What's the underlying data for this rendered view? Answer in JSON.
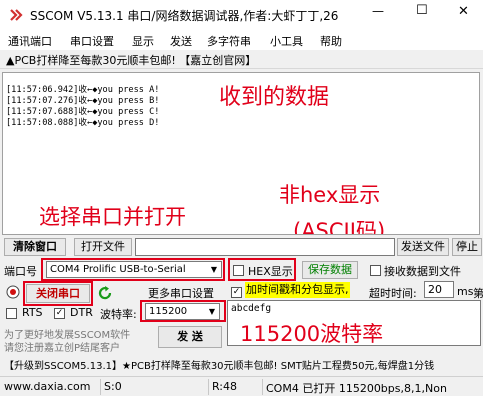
{
  "window": {
    "title": "SSCOM V5.13.1 串口/网络数据调试器,作者:大虾丁丁,26",
    "min_glyph": "—",
    "max_glyph": "☐",
    "close_glyph": "✕"
  },
  "menu": [
    "通讯端口",
    "串口设置",
    "显示",
    "发送",
    "多字符串",
    "小工具",
    "帮助"
  ],
  "ad_bar": "▲PCB打样降至每款30元顺丰包邮!  【嘉立创官网】",
  "receive_lines": [
    "[11:57:06.942]收←◆you press A!",
    "[11:57:07.276]收←◆you press B!",
    "[11:57:07.688]收←◆you press C!",
    "[11:57:08.088]收←◆you press D!"
  ],
  "annotations": {
    "received": "收到的数据",
    "select_port": "选择串口并打开",
    "non_hex": "非hex显示",
    "ascii": "(ASCII码)",
    "baud": "115200波特率"
  },
  "toolbar": {
    "clear_window": "清除窗口",
    "open_file": "打开文件",
    "send_file": "发送文件",
    "stop": "停止"
  },
  "port_row": {
    "port_label": "端口号",
    "port_value": "COM4 Prolific USB-to-Serial",
    "hex_display_label": "HEX显示",
    "save_data": "保存数据",
    "recv_to_file": "接收数据到文件"
  },
  "row3": {
    "close_port": "关闭串口",
    "more_settings": "更多串口设置",
    "timestamp_label": "加时间戳和分包显示,",
    "timeout_label": "超时时间:",
    "timeout_value": "20",
    "timeout_unit": "ms",
    "rest_label": "第"
  },
  "row4": {
    "rts": "RTS",
    "dtr": "DTR",
    "baud_label": "波特率:",
    "baud_value": "115200",
    "send_text": "abcdefg"
  },
  "promo": {
    "line1": "为了更好地发展SSCOM软件",
    "line2": "请您注册嘉立创P结尾客户",
    "send_button": "发 送"
  },
  "ticker": "【升级到SSCOM5.13.1】★PCB打样降至每款30元顺丰包邮! SMT贴片工程费50元,每焊盘1分钱",
  "status_bar": {
    "website": "www.daxia.com",
    "sent": "S:0",
    "received": "R:48",
    "port_status": "COM4 已打开  115200bps,8,1,Non"
  },
  "colors": {
    "annotation_red": "#e1001a",
    "save_green": "#008000",
    "refresh_green": "#1a9a1a"
  }
}
